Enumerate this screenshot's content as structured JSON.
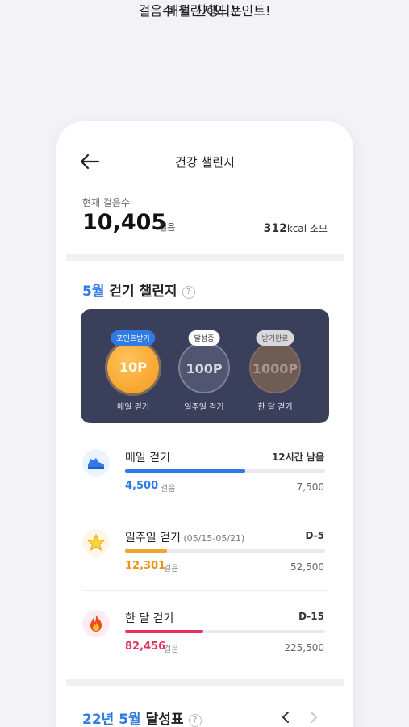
{
  "promo": {
    "line1": "매월 진행되는",
    "line2": "걸음수 챌린지와 포인트!"
  },
  "header": {
    "title": "건강 챌린지"
  },
  "current": {
    "label": "현재 걸음수",
    "steps": "10,405",
    "steps_unit": "걸음",
    "kcal_value": "312",
    "kcal_unit": "kcal 소모"
  },
  "challenge": {
    "title_accent": "5월",
    "title_rest": " 걷기 챌린지",
    "rewards": [
      {
        "badge": "포인트받기",
        "points": "10P",
        "label": "매일 걷기"
      },
      {
        "badge": "달성중",
        "points": "100P",
        "label": "일주일 걷기"
      },
      {
        "badge": "받기완료",
        "points": "1000P",
        "label": "한 달 걷기"
      }
    ]
  },
  "items": [
    {
      "name": "매일 걷기",
      "sub": "",
      "status": "12시간 남음",
      "current": "4,500",
      "unit": "걸음",
      "goal": "7,500",
      "progress": 0.6,
      "icon": "sneaker-icon"
    },
    {
      "name": "일주일 걷기",
      "sub": " (05/15-05/21)",
      "status": "D-5",
      "current": "12,301",
      "unit": "걸음",
      "goal": "52,500",
      "progress": 0.21,
      "icon": "star-icon"
    },
    {
      "name": "한 달 걷기",
      "sub": "",
      "status": "D-15",
      "current": "82,456",
      "unit": "걸음",
      "goal": "225,500",
      "progress": 0.39,
      "icon": "fire-icon"
    }
  ],
  "achievement": {
    "title_accent": "22년 5월",
    "title_rest": " 달성표"
  },
  "colors": {
    "accent_blue": "#2f7ae5",
    "accent_pink": "#ee2f6b",
    "card_bg": "#3a3f5c"
  }
}
